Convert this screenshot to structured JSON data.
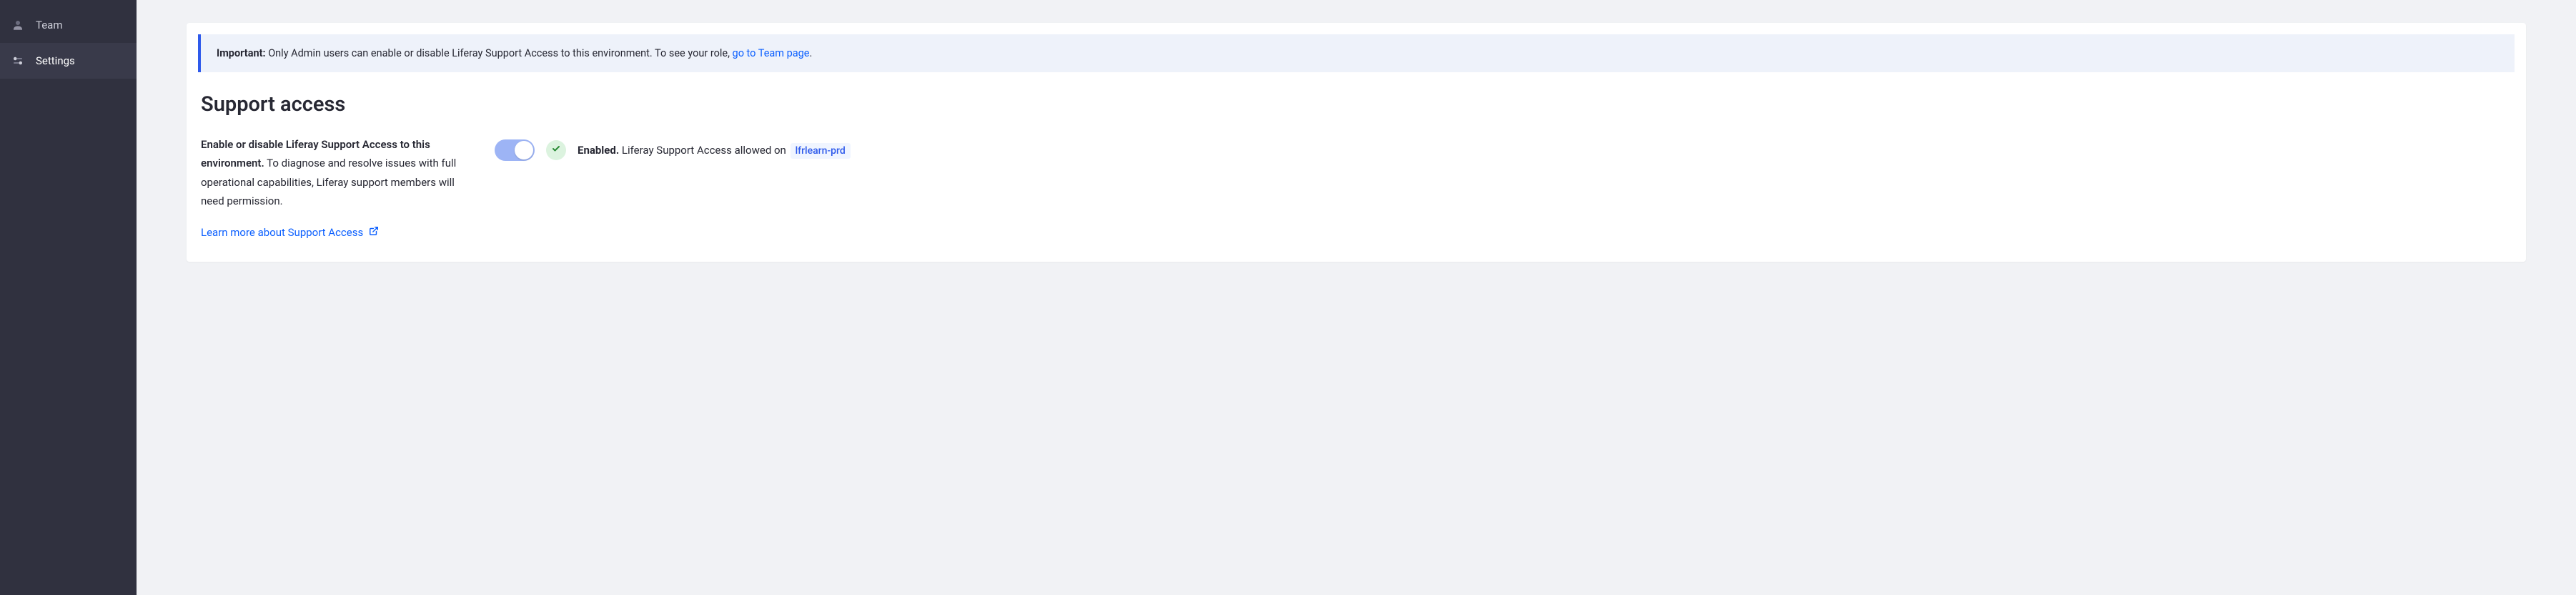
{
  "sidebar": {
    "items": [
      {
        "label": "Team",
        "active": false
      },
      {
        "label": "Settings",
        "active": true
      }
    ]
  },
  "alert": {
    "prefix": "Important:",
    "body": " Only Admin users can enable or disable Liferay Support Access to this environment. To see your role, ",
    "link_text": "go to Team page",
    "suffix": "."
  },
  "section": {
    "title": "Support access",
    "lead": "Enable or disable Liferay Support Access to this environment.",
    "body": " To diagnose and resolve issues with full operational capabilities, Liferay support members will need permission.",
    "learn_more": "Learn more about Support Access"
  },
  "status": {
    "enabled_label": "Enabled.",
    "body": " Liferay Support Access allowed on ",
    "env": "lfrlearn-prd"
  }
}
